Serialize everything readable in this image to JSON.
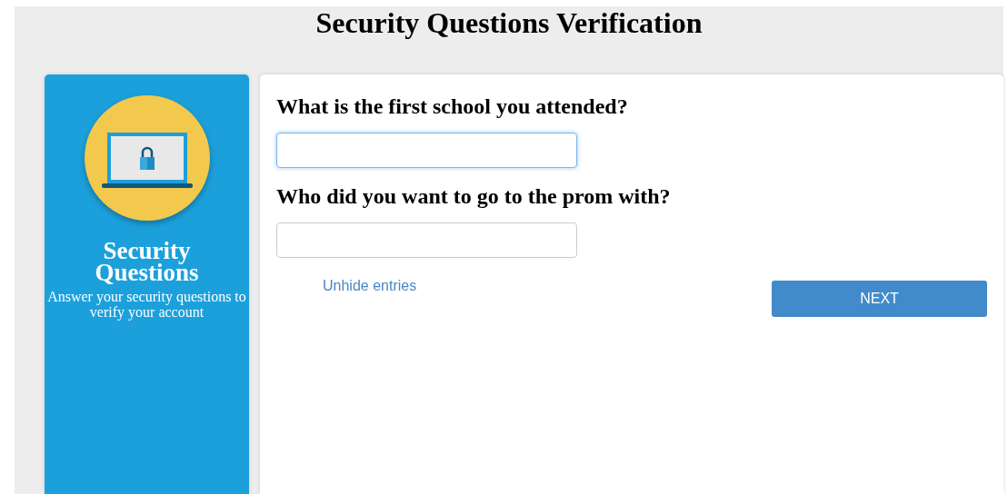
{
  "title": "Security Questions Verification",
  "sidebar": {
    "heading": "Security Questions",
    "description": "Answer your security questions to verify your account"
  },
  "questions": [
    {
      "label": "What is the first school you attended?",
      "focused": true
    },
    {
      "label": "Who did you want to go to the prom with?",
      "focused": false
    }
  ],
  "unhide_link": "Unhide entries",
  "next_button": "NEXT"
}
